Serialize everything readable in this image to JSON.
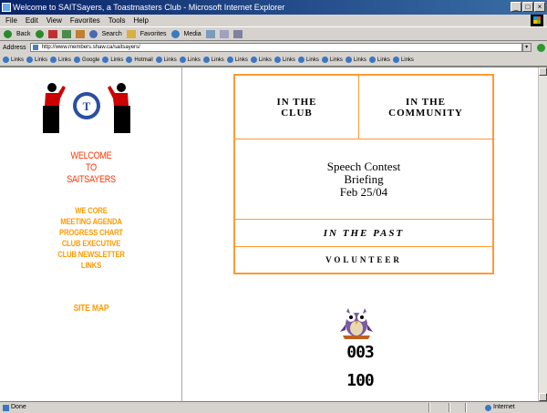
{
  "window": {
    "title": "Welcome to SAITSayers, a Toastmasters Club - Microsoft Internet Explorer"
  },
  "menu": [
    "File",
    "Edit",
    "View",
    "Favorites",
    "Tools",
    "Help"
  ],
  "toolbar": {
    "back": "Back",
    "search": "Search",
    "favorites": "Favorites",
    "media": "Media"
  },
  "address": {
    "label": "Address",
    "url": "http://www.members.shaw.ca/saitsayers/"
  },
  "links_bar": [
    "Links",
    "Links",
    "Links",
    "Google",
    "Links",
    "Hotmail",
    "Links",
    "Links",
    "Links",
    "Links",
    "Links",
    "Links",
    "Links",
    "Links",
    "Links",
    "Links",
    "Links"
  ],
  "sidebar": {
    "welcome": [
      "WELCOME",
      "TO",
      "SAITSAYERS"
    ],
    "links": [
      "WE CORE",
      "MEETING AGENDA",
      "PROGRESS CHART",
      "CLUB EXECUTIVE",
      "CLUB NEWSLETTER",
      "LINKS"
    ],
    "site_map": "SITE MAP"
  },
  "main": {
    "in_the_club": [
      "IN THE",
      "CLUB"
    ],
    "in_the_community": [
      "IN THE",
      "COMMUNITY"
    ],
    "speech_contest": [
      "Speech Contest",
      "Briefing",
      "Feb 25/04"
    ],
    "in_the_past": "IN THE PAST",
    "volunteer": "VOLUNTEER",
    "counter_1": "003",
    "counter_2": "100"
  },
  "status": {
    "left": "Done",
    "zone": "Internet"
  },
  "colors": {
    "accent_orange": "#ff9a33",
    "welcome_red": "#ff3300",
    "link_orange": "#ff9a00"
  }
}
